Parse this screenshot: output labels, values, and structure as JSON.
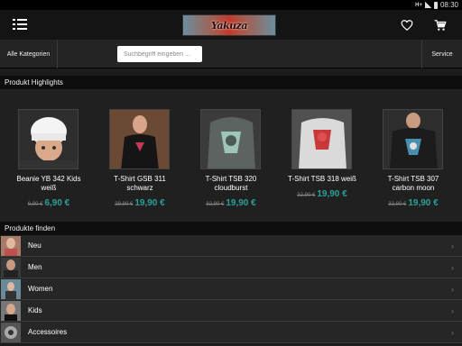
{
  "status": {
    "network": "H+",
    "time": "08:30"
  },
  "header": {
    "logo_text": "Yakuza"
  },
  "search": {
    "category_label": "Alle Kategorien",
    "placeholder": "Suchbegriff eingeben ...",
    "service_label": "Service"
  },
  "highlights": {
    "title": "Produkt Highlights",
    "products": [
      {
        "name": "Beanie YB 342 Kids weiß",
        "old_price": "9,90 €",
        "price": "6,90 €"
      },
      {
        "name": "T-Shirt GSB 311 schwarz",
        "old_price": "29,90 €",
        "price": "19,90 €"
      },
      {
        "name": "T-Shirt TSB 320 cloudburst",
        "old_price": "32,90 €",
        "price": "19,90 €"
      },
      {
        "name": "T-Shirt TSB 318 weiß",
        "old_price": "32,90 €",
        "price": "19,90 €"
      },
      {
        "name": "T-Shirt TSB 307 carbon moon",
        "old_price": "32,90 €",
        "price": "19,90 €"
      }
    ]
  },
  "finder": {
    "title": "Produkte finden",
    "categories": [
      {
        "label": "Neu"
      },
      {
        "label": "Men"
      },
      {
        "label": "Women"
      },
      {
        "label": "Kids"
      },
      {
        "label": "Accessoires"
      }
    ]
  },
  "colors": {
    "accent": "#2aa198",
    "background": "#1c1c1c"
  }
}
